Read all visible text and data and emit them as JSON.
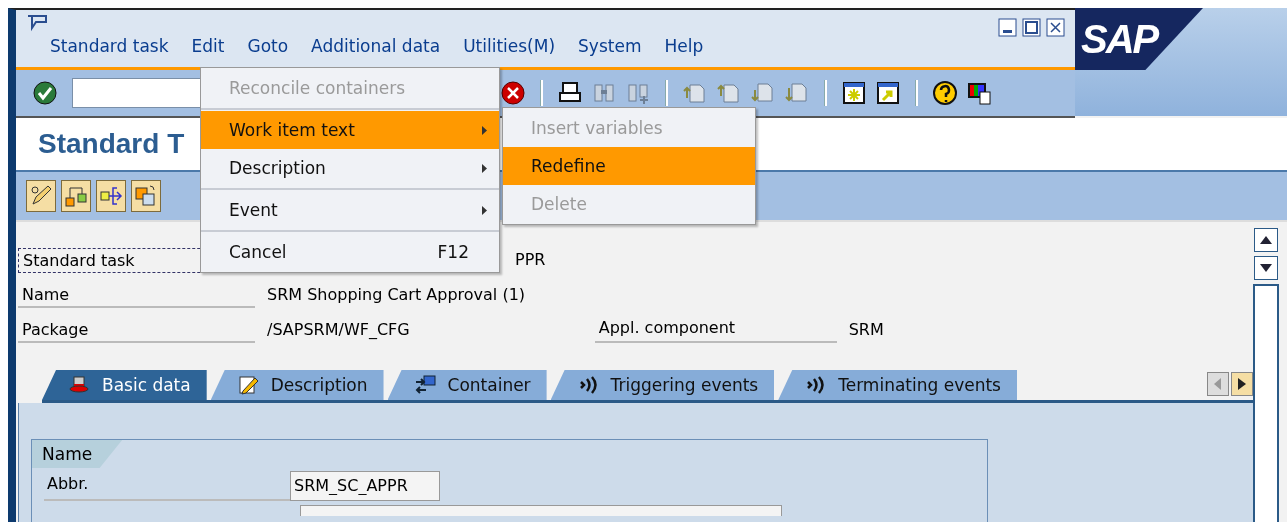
{
  "menu_bar": [
    "Standard task",
    "Edit",
    "Goto",
    "Additional data",
    "Utilities(M)",
    "System",
    "Help"
  ],
  "logo": "SAP",
  "title": "Standard T",
  "edit_menu": {
    "groups": [
      [
        {
          "label": "Reconcile containers",
          "disabled": true,
          "selected": false,
          "submenu": false
        }
      ],
      [
        {
          "label": "Work item text",
          "disabled": false,
          "selected": true,
          "submenu": true
        },
        {
          "label": "Description",
          "disabled": false,
          "selected": false,
          "submenu": true
        }
      ],
      [
        {
          "label": "Event",
          "disabled": false,
          "selected": false,
          "submenu": true
        }
      ],
      [
        {
          "label": "Cancel",
          "disabled": false,
          "selected": false,
          "submenu": false,
          "shortcut": "F12"
        }
      ]
    ]
  },
  "submenu": [
    {
      "label": "Insert variables",
      "disabled": true,
      "selected": false
    },
    {
      "label": "Redefine",
      "disabled": false,
      "selected": true
    },
    {
      "label": "Delete",
      "disabled": true,
      "selected": false
    }
  ],
  "fields": [
    {
      "label": "Standard task",
      "value": "PPR",
      "focused": true
    },
    {
      "label": "Name",
      "value": "SRM Shopping Cart Approval (1)",
      "focused": false
    },
    {
      "label": "Package",
      "value": "/SAPSRM/WF_CFG",
      "focused": false
    }
  ],
  "appl_component": {
    "label": "Appl. component",
    "value": "SRM"
  },
  "tabs": [
    {
      "label": "Basic data",
      "selected": true
    },
    {
      "label": "Description",
      "selected": false
    },
    {
      "label": "Container",
      "selected": false
    },
    {
      "label": "Triggering events",
      "selected": false
    },
    {
      "label": "Terminating events",
      "selected": false
    }
  ],
  "group": {
    "title": "Name",
    "rows": [
      {
        "label": "Abbr.",
        "value": "SRM_SC_APPR"
      }
    ]
  }
}
